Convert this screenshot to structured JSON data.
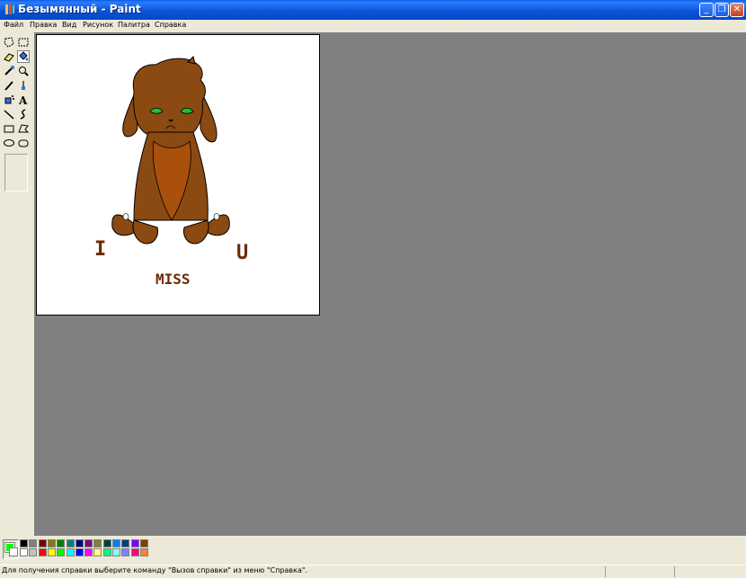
{
  "window": {
    "title": "Безымянный - Paint",
    "minimize_label": "_",
    "restore_label": "❐",
    "close_label": "✕"
  },
  "menu": [
    "Файл",
    "Правка",
    "Вид",
    "Рисунок",
    "Палитра",
    "Справка"
  ],
  "tools": [
    "free-select-icon",
    "select-icon",
    "eraser-icon",
    "fill-icon",
    "color-picker-icon",
    "magnifier-icon",
    "pencil-icon",
    "brush-icon",
    "airbrush-icon",
    "text-icon",
    "line-icon",
    "curve-icon",
    "rectangle-icon",
    "polygon-icon",
    "ellipse-icon",
    "rounded-rectangle-icon"
  ],
  "canvas": {
    "text_i": "I",
    "text_u": "U",
    "text_miss": "MISS",
    "ink_color": "#6B2A04",
    "fur_color": "#8B4A12",
    "belly_color": "#A8500C",
    "eye_color": "#1FBF3F"
  },
  "colors": {
    "foreground": "#00FF00",
    "background": "#FFFFFF",
    "palette_row1": [
      "#000000",
      "#808080",
      "#800000",
      "#808000",
      "#008000",
      "#008080",
      "#000080",
      "#800080",
      "#808040",
      "#004040",
      "#0080FF",
      "#004080",
      "#8000FF",
      "#804000"
    ],
    "palette_row2": [
      "#FFFFFF",
      "#C0C0C0",
      "#FF0000",
      "#FFFF00",
      "#00FF00",
      "#00FFFF",
      "#0000FF",
      "#FF00FF",
      "#FFFF80",
      "#00FF80",
      "#80FFFF",
      "#8080FF",
      "#FF0080",
      "#FF8040"
    ]
  },
  "status": {
    "help_text": "Для получения справки выберите команду \"Вызов справки\" из меню \"Справка\"."
  }
}
